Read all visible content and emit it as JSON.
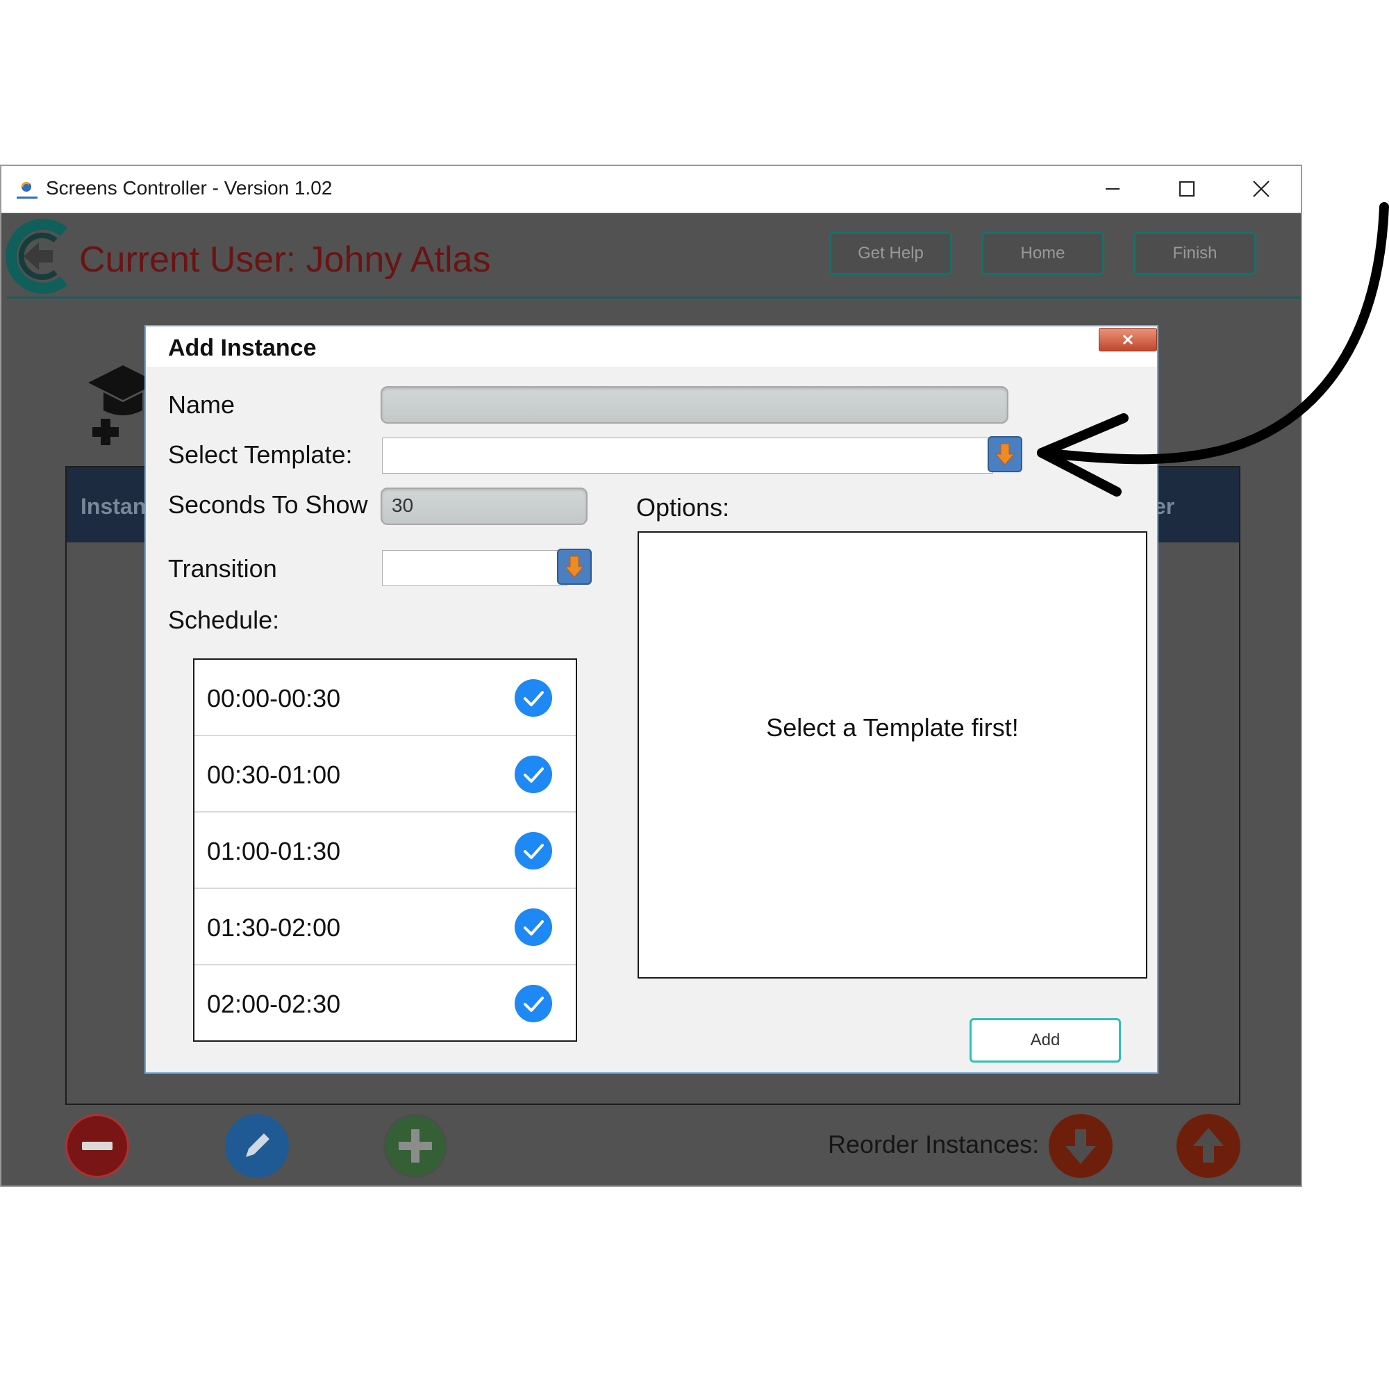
{
  "window": {
    "title": "Screens Controller - Version 1.02"
  },
  "header": {
    "current_user": "Current User: Johny Atlas",
    "buttons": [
      "Get Help",
      "Home",
      "Finish"
    ]
  },
  "panel": {
    "header_left": "Instan",
    "header_right": "er"
  },
  "footer": {
    "reorder_label": "Reorder Instances:"
  },
  "dialog": {
    "title": "Add Instance",
    "name_label": "Name",
    "name_value": "",
    "template_label": "Select Template:",
    "template_value": "",
    "seconds_label": "Seconds To Show",
    "seconds_value": "30",
    "transition_label": "Transition",
    "transition_value": "",
    "schedule_label": "Schedule:",
    "schedule": [
      {
        "time": "00:00-00:30",
        "checked": true
      },
      {
        "time": "00:30-01:00",
        "checked": true
      },
      {
        "time": "01:00-01:30",
        "checked": true
      },
      {
        "time": "01:30-02:00",
        "checked": true
      },
      {
        "time": "02:00-02:30",
        "checked": true
      }
    ],
    "options_label": "Options:",
    "options_placeholder": "Select a Template first!",
    "add_label": "Add"
  },
  "colors": {
    "accent_teal": "#17706a",
    "user_text": "#6b1313",
    "check_blue": "#1e88f5",
    "dropdown_blue": "#4a7fc1",
    "dropdown_arrow": "#f08a24"
  },
  "icons": [
    "app-icon",
    "logo-icon",
    "minimize-icon",
    "maximize-icon",
    "close-icon",
    "graduation-cap-plus-icon",
    "remove-icon",
    "edit-icon",
    "add-icon",
    "arrow-down-icon",
    "arrow-up-icon",
    "dropdown-arrow-icon",
    "check-icon"
  ]
}
